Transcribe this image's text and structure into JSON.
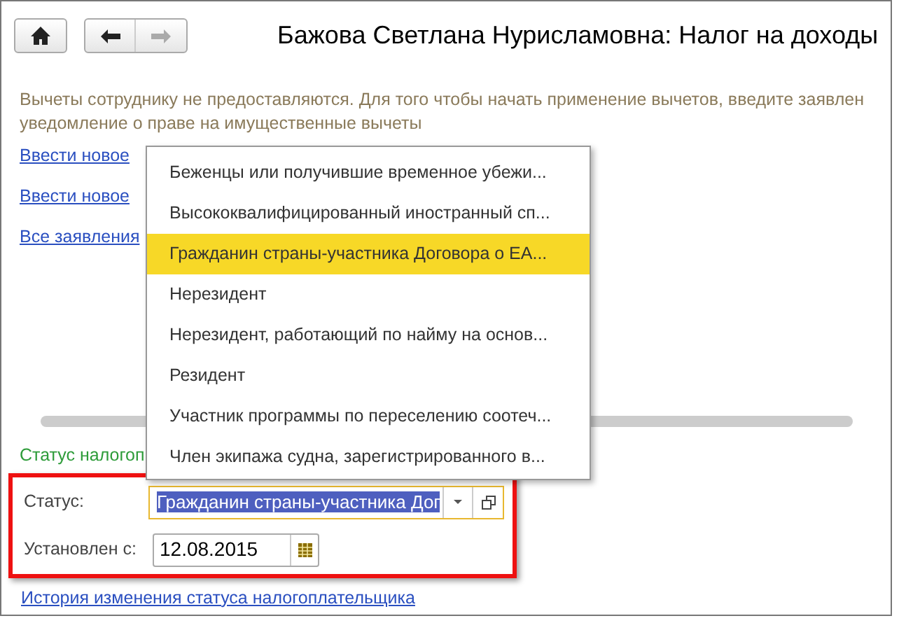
{
  "window": {
    "title": "Бажова Светлана Нурисламовна: Налог на доходы"
  },
  "note": [
    "Вычеты сотруднику не предоставляются. Для того чтобы начать применение вычетов, введите заявлен",
    "уведомление о праве на имущественные вычеты"
  ],
  "links": [
    "Ввести новое",
    "Ввести новое",
    "Все заявления"
  ],
  "section_heading": "Статус налогоп",
  "status_field": {
    "label": "Статус:",
    "value": "Гражданин страны-участника Дог"
  },
  "date_field": {
    "label": "Установлен с:",
    "value": "12.08.2015"
  },
  "history_link": "История изменения статуса налогоплательщика",
  "dropdown": [
    {
      "label": "Беженцы или получившие временное убежи...",
      "selected": false
    },
    {
      "label": "Высококвалифицированный иностранный сп...",
      "selected": false
    },
    {
      "label": "Гражданин страны-участника Договора о ЕА...",
      "selected": true
    },
    {
      "label": "Нерезидент",
      "selected": false
    },
    {
      "label": "Нерезидент, работающий по найму на основ...",
      "selected": false
    },
    {
      "label": "Резидент",
      "selected": false
    },
    {
      "label": "Участник программы по переселению соотеч...",
      "selected": false
    },
    {
      "label": "Член экипажа судна, зарегистрированного в...",
      "selected": false
    }
  ]
}
